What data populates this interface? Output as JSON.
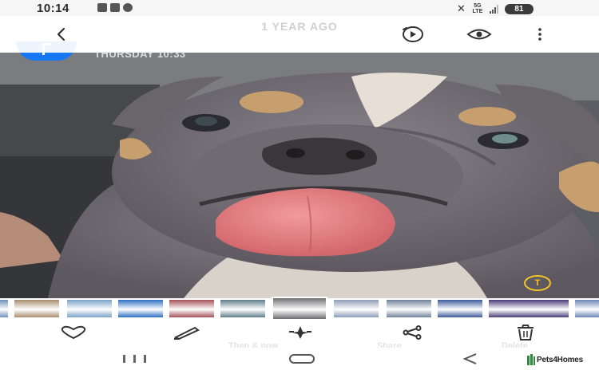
{
  "status_bar": {
    "time": "10:14",
    "net_label_top": "5G",
    "net_label_bottom": "LTE",
    "battery": "81"
  },
  "toolbar": {
    "title": "1 YEAR AGO",
    "back_icon": "chevron-left-icon",
    "remaster_icon": "play-circle-icon",
    "view_icon": "eye-icon",
    "more_icon": "more-vertical-icon"
  },
  "photo_header": {
    "date_label": "THURSDAY 10:33"
  },
  "photo": {
    "subject": "bulldog puppy",
    "sticker_glyph": "T",
    "colors": {
      "fur_grey": "#77727a",
      "tan": "#c79e6e",
      "tongue": "#e27d80",
      "cream": "#e7dfd6"
    }
  },
  "filmstrip": {
    "current_index": 5,
    "thumbs": [
      {
        "color": "#6f8fb8"
      },
      {
        "color": "#a88c6d"
      },
      {
        "color": "#7ba2c8"
      },
      {
        "color": "#2d6fc2"
      },
      {
        "color": "#a44f56"
      },
      {
        "color": "#5f7d8a"
      },
      {
        "color": "#6e6d70"
      },
      {
        "color": "#8d9bb5"
      },
      {
        "color": "#6f8199"
      },
      {
        "color": "#3d5a9a"
      },
      {
        "color": "#4a3c78"
      },
      {
        "color": "#6d86b6"
      }
    ]
  },
  "bottom_actions": [
    {
      "name": "favorite",
      "icon": "heart-icon",
      "label": ""
    },
    {
      "name": "edit",
      "icon": "pencil-icon",
      "label": ""
    },
    {
      "name": "then-and-now",
      "icon": "sparkle-icon",
      "label": "Then & now"
    },
    {
      "name": "share",
      "icon": "share-icon",
      "label": "Share"
    },
    {
      "name": "delete",
      "icon": "trash-icon",
      "label": "Delete"
    }
  ],
  "nav_bar": {
    "watermark": "Pets4Homes"
  }
}
